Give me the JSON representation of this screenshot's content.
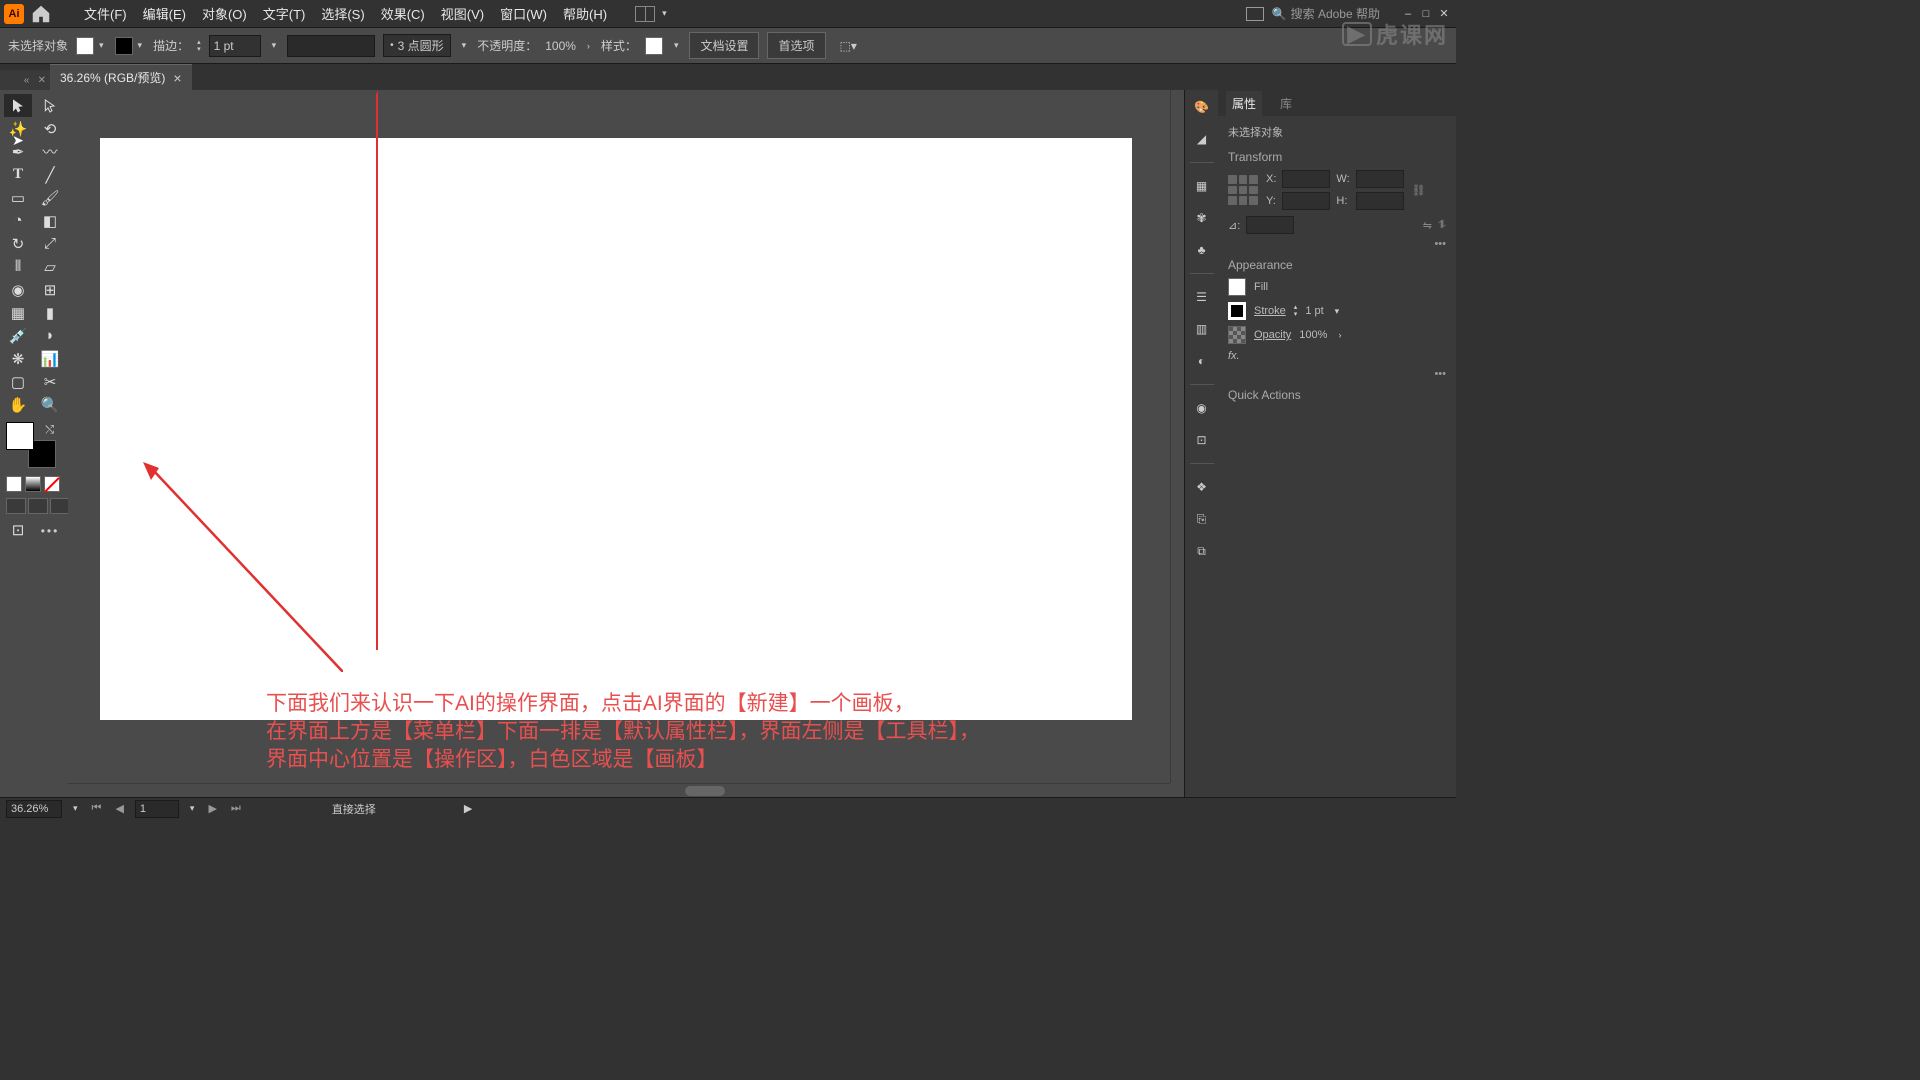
{
  "app": {
    "logo": "Ai"
  },
  "menus": {
    "file": "文件(F)",
    "edit": "编辑(E)",
    "object": "对象(O)",
    "type": "文字(T)",
    "select": "选择(S)",
    "effect": "效果(C)",
    "view": "视图(V)",
    "window": "窗口(W)",
    "help": "帮助(H)"
  },
  "search": {
    "placeholder": "搜索 Adobe 帮助"
  },
  "watermark": "虎课网",
  "control": {
    "no_selection": "未选择对象",
    "stroke_label": "描边：",
    "stroke_value": "1 pt",
    "brush_label": "3 点圆形",
    "opacity_label": "不透明度：",
    "opacity_value": "100%",
    "style_label": "样式：",
    "doc_setup": "文档设置",
    "prefs": "首选项"
  },
  "doc_tab": {
    "title": "36.26% (RGB/预览)"
  },
  "annotation": {
    "line1": "下面我们来认识一下AI的操作界面，点击AI界面的【新建】一个画板，",
    "line2": "在界面上方是【菜单栏】下面一排是【默认属性栏】，界面左侧是【工具栏】，",
    "line3": "界面中心位置是【操作区】，白色区域是【画板】"
  },
  "panels": {
    "tab_props": "属性",
    "tab_lib": "库",
    "no_sel": "未选择对象",
    "transform": "Transform",
    "x_label": "X:",
    "y_label": "Y:",
    "w_label": "W:",
    "h_label": "H:",
    "angle_label": "⊿:",
    "appearance": "Appearance",
    "fill": "Fill",
    "stroke": "Stroke",
    "stroke_val": "1 pt",
    "opacity": "Opacity",
    "opacity_val": "100%",
    "fx": "fx.",
    "quick_actions": "Quick Actions"
  },
  "status": {
    "zoom": "36.26%",
    "artboard_num": "1",
    "tool_hint": "直接选择"
  }
}
